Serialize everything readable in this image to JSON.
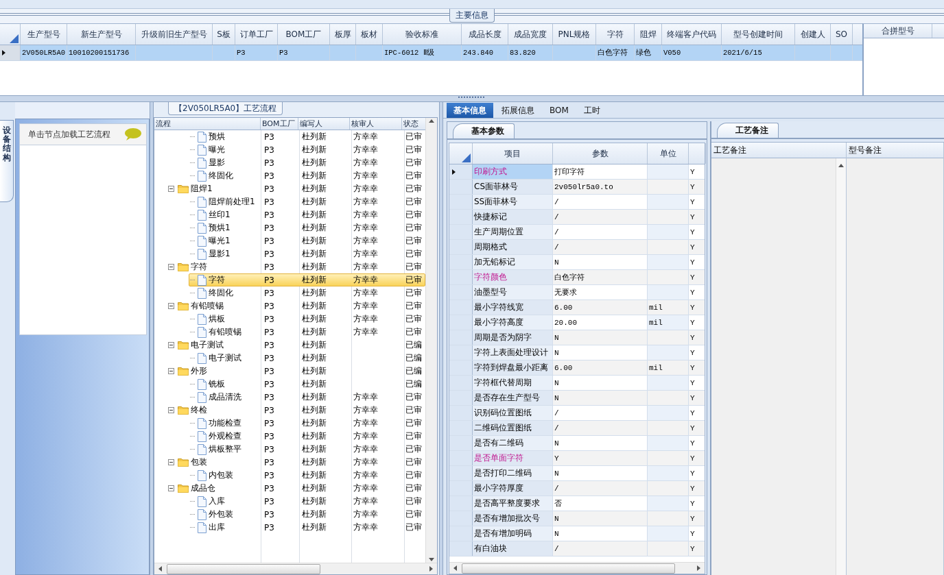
{
  "main_info": {
    "title": "主要信息",
    "columns": [
      "生产型号",
      "新生产型号",
      "升级前旧生产型号",
      "S板",
      "订单工厂",
      "BOM工厂",
      "板厚",
      "板材",
      "验收标准",
      "成品长度",
      "成品宽度",
      "PNL规格",
      "字符",
      "阻焊",
      "终端客户代码",
      "型号创建时间",
      "创建人",
      "SO"
    ],
    "rows": [
      {
        "selected": true,
        "cells": [
          "2V050LR5A0",
          "10010200151736",
          null,
          null,
          "P3",
          "P3",
          null,
          null,
          "IPC-6012 Ⅱ级",
          "243.840",
          "83.820",
          null,
          "白色字符",
          "绿色",
          "V050",
          "2021/6/15",
          null,
          null
        ]
      }
    ]
  },
  "merge_panel": {
    "columns": [
      "合拼型号"
    ]
  },
  "side_panel": {
    "tab": "设备结构",
    "hint": "单击节点加载工艺流程"
  },
  "process_flow": {
    "title": "【2V050LR5A0】工艺流程",
    "columns": [
      "流程",
      "BOM工厂",
      "编写人",
      "核审人",
      "状态"
    ],
    "tree": [
      {
        "children": [
          {
            "label": "预烘",
            "bom": "P3",
            "writer": "杜列新",
            "reviewer": "方幸幸",
            "status": "已审",
            "selected": false
          },
          {
            "label": "曝光",
            "bom": "P3",
            "writer": "杜列新",
            "reviewer": "方幸幸",
            "status": "已审",
            "selected": false
          },
          {
            "label": "显影",
            "bom": "P3",
            "writer": "杜列新",
            "reviewer": "方幸幸",
            "status": "已审",
            "selected": false
          },
          {
            "label": "终固化",
            "bom": "P3",
            "writer": "杜列新",
            "reviewer": "方幸幸",
            "status": "已审",
            "selected": false
          }
        ]
      },
      {
        "label": "阻焊1",
        "bom": "P3",
        "writer": "杜列新",
        "reviewer": "方幸幸",
        "status": "已审",
        "selected": false,
        "expanded": true,
        "children": [
          {
            "label": "阻焊前处理1",
            "bom": "P3",
            "writer": "杜列新",
            "reviewer": "方幸幸",
            "status": "已审",
            "selected": false
          },
          {
            "label": "丝印1",
            "bom": "P3",
            "writer": "杜列新",
            "reviewer": "方幸幸",
            "status": "已审",
            "selected": false
          },
          {
            "label": "预烘1",
            "bom": "P3",
            "writer": "杜列新",
            "reviewer": "方幸幸",
            "status": "已审",
            "selected": false
          },
          {
            "label": "曝光1",
            "bom": "P3",
            "writer": "杜列新",
            "reviewer": "方幸幸",
            "status": "已审",
            "selected": false
          },
          {
            "label": "显影1",
            "bom": "P3",
            "writer": "杜列新",
            "reviewer": "方幸幸",
            "status": "已审",
            "selected": false
          }
        ]
      },
      {
        "label": "字符",
        "bom": "P3",
        "writer": "杜列新",
        "reviewer": "方幸幸",
        "status": "已审",
        "selected": false,
        "expanded": true,
        "children": [
          {
            "label": "字符",
            "bom": "P3",
            "writer": "杜列新",
            "reviewer": "方幸幸",
            "status": "已审",
            "selected": true
          },
          {
            "label": "终固化",
            "bom": "P3",
            "writer": "杜列新",
            "reviewer": "方幸幸",
            "status": "已审",
            "selected": false
          }
        ]
      },
      {
        "label": "有铅喷锡",
        "bom": "P3",
        "writer": "杜列新",
        "reviewer": "方幸幸",
        "status": "已审",
        "selected": false,
        "expanded": true,
        "children": [
          {
            "label": "烘板",
            "bom": "P3",
            "writer": "杜列新",
            "reviewer": "方幸幸",
            "status": "已审",
            "selected": false
          },
          {
            "label": "有铅喷锡",
            "bom": "P3",
            "writer": "杜列新",
            "reviewer": "方幸幸",
            "status": "已审",
            "selected": false
          }
        ]
      },
      {
        "label": "电子测试",
        "bom": "P3",
        "writer": "杜列新",
        "status": "已编",
        "selected": false,
        "expanded": true,
        "children": [
          {
            "label": "电子测试",
            "bom": "P3",
            "writer": "杜列新",
            "status": "已编",
            "selected": false
          }
        ]
      },
      {
        "label": "外形",
        "bom": "P3",
        "writer": "杜列新",
        "status": "已编",
        "selected": false,
        "expanded": true,
        "children": [
          {
            "label": "铣板",
            "bom": "P3",
            "writer": "杜列新",
            "status": "已编",
            "selected": false
          },
          {
            "label": "成品清洗",
            "bom": "P3",
            "writer": "杜列新",
            "reviewer": "方幸幸",
            "status": "已审",
            "selected": false
          }
        ]
      },
      {
        "label": "终检",
        "bom": "P3",
        "writer": "杜列新",
        "reviewer": "方幸幸",
        "status": "已审",
        "selected": false,
        "expanded": true,
        "children": [
          {
            "label": "功能检查",
            "bom": "P3",
            "writer": "杜列新",
            "reviewer": "方幸幸",
            "status": "已审",
            "selected": false
          },
          {
            "label": "外观检查",
            "bom": "P3",
            "writer": "杜列新",
            "reviewer": "方幸幸",
            "status": "已审",
            "selected": false
          },
          {
            "label": "烘板整平",
            "bom": "P3",
            "writer": "杜列新",
            "reviewer": "方幸幸",
            "status": "已审",
            "selected": false
          }
        ]
      },
      {
        "label": "包装",
        "bom": "P3",
        "writer": "杜列新",
        "reviewer": "方幸幸",
        "status": "已审",
        "selected": false,
        "expanded": true,
        "children": [
          {
            "label": "内包装",
            "bom": "P3",
            "writer": "杜列新",
            "reviewer": "方幸幸",
            "status": "已审",
            "selected": false
          }
        ]
      },
      {
        "label": "成品仓",
        "bom": "P3",
        "writer": "杜列新",
        "reviewer": "方幸幸",
        "status": "已审",
        "selected": false,
        "expanded": true,
        "children": [
          {
            "label": "入库",
            "bom": "P3",
            "writer": "杜列新",
            "reviewer": "方幸幸",
            "status": "已审",
            "selected": false
          },
          {
            "label": "外包装",
            "bom": "P3",
            "writer": "杜列新",
            "reviewer": "方幸幸",
            "status": "已审",
            "selected": false
          },
          {
            "label": "出库",
            "bom": "P3",
            "writer": "杜列新",
            "reviewer": "方幸幸",
            "status": "已审",
            "selected": false
          }
        ]
      }
    ]
  },
  "tabs": [
    {
      "label": "基本信息",
      "selected": true
    },
    {
      "label": "拓展信息",
      "selected": false
    },
    {
      "label": "BOM",
      "selected": false
    },
    {
      "label": "工时",
      "selected": false
    }
  ],
  "params": {
    "tab": "基本参数",
    "columns": [
      "项目",
      "参数",
      "单位"
    ],
    "rows": [
      {
        "item": "印刷方式",
        "value": "打印字符",
        "flag": "Y",
        "highlighted": true,
        "selected": true
      },
      {
        "item": "CS面菲林号",
        "value": "2v050lr5a0.to",
        "flag": "Y",
        "highlighted": false,
        "selected": false
      },
      {
        "item": "SS面菲林号",
        "value": "/",
        "flag": "Y",
        "highlighted": false,
        "selected": false
      },
      {
        "item": "快捷标记",
        "value": "/",
        "flag": "Y",
        "highlighted": false,
        "selected": false
      },
      {
        "item": "生产周期位置",
        "value": "/",
        "flag": "Y",
        "highlighted": false,
        "selected": false
      },
      {
        "item": "周期格式",
        "value": "/",
        "flag": "Y",
        "highlighted": false,
        "selected": false
      },
      {
        "item": "加无铅标记",
        "value": "N",
        "flag": "Y",
        "highlighted": false,
        "selected": false
      },
      {
        "item": "字符颜色",
        "value": "白色字符",
        "flag": "Y",
        "highlighted": true,
        "selected": false
      },
      {
        "item": "油墨型号",
        "value": "无要求",
        "flag": "Y",
        "highlighted": false,
        "selected": false
      },
      {
        "item": "最小字符线宽",
        "value": "6.00",
        "unit": "mil",
        "flag": "Y",
        "highlighted": false,
        "selected": false
      },
      {
        "item": "最小字符高度",
        "value": "20.00",
        "unit": "mil",
        "flag": "Y",
        "highlighted": false,
        "selected": false
      },
      {
        "item": "周期是否为阴字",
        "value": "N",
        "flag": "Y",
        "highlighted": false,
        "selected": false
      },
      {
        "item": "字符上表面处理设计",
        "value": "N",
        "flag": "Y",
        "highlighted": false,
        "selected": false
      },
      {
        "item": "字符到焊盘最小距离",
        "value": "6.00",
        "unit": "mil",
        "flag": "Y",
        "highlighted": false,
        "selected": false
      },
      {
        "item": "字符框代替周期",
        "value": "N",
        "flag": "Y",
        "highlighted": false,
        "selected": false
      },
      {
        "item": "是否存在生产型号",
        "value": "N",
        "flag": "Y",
        "highlighted": false,
        "selected": false
      },
      {
        "item": "识别码位置图纸",
        "value": "/",
        "flag": "Y",
        "highlighted": false,
        "selected": false
      },
      {
        "item": "二维码位置图纸",
        "value": "/",
        "flag": "Y",
        "highlighted": false,
        "selected": false
      },
      {
        "item": "是否有二维码",
        "value": "N",
        "flag": "Y",
        "highlighted": false,
        "selected": false
      },
      {
        "item": "是否单面字符",
        "value": "Y",
        "flag": "Y",
        "highlighted": true,
        "selected": false
      },
      {
        "item": "是否打印二维码",
        "value": "N",
        "flag": "Y",
        "highlighted": false,
        "selected": false
      },
      {
        "item": "最小字符厚度",
        "value": "/",
        "flag": "Y",
        "highlighted": false,
        "selected": false
      },
      {
        "item": "是否高平整度要求",
        "value": "否",
        "flag": "Y",
        "highlighted": false,
        "selected": false
      },
      {
        "item": "是否有增加批次号",
        "value": "N",
        "flag": "Y",
        "highlighted": false,
        "selected": false
      },
      {
        "item": "是否有增加明码",
        "value": "N",
        "flag": "Y",
        "highlighted": false,
        "selected": false
      },
      {
        "item": "有白油块",
        "value": "/",
        "flag": "Y",
        "highlighted": false,
        "selected": false
      }
    ]
  },
  "remarks": {
    "tab": "工艺备注",
    "columns": [
      "工艺备注",
      "型号备注"
    ]
  }
}
